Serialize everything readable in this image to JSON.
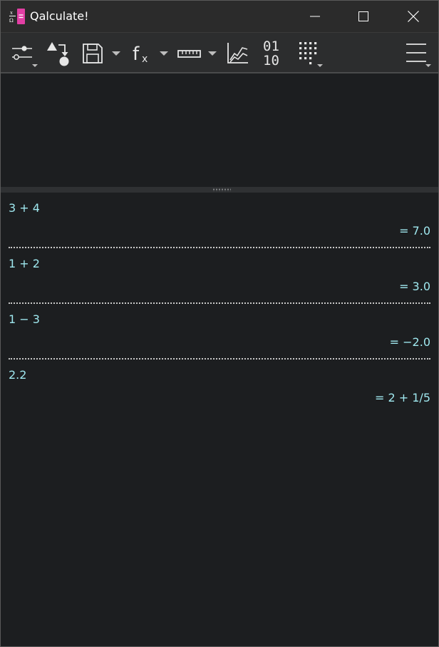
{
  "window": {
    "title": "Qalculate!",
    "app_icon": "qalculate-app-icon"
  },
  "toolbar": {
    "buttons": [
      {
        "icon": "mode-sliders-icon",
        "has_menu": true
      },
      {
        "icon": "convert-icon",
        "has_menu": false
      },
      {
        "icon": "save-icon",
        "has_menu": true
      },
      {
        "icon": "function-icon",
        "label": "f",
        "sub": "x",
        "has_menu": true
      },
      {
        "icon": "units-ruler-icon",
        "has_menu": true
      },
      {
        "icon": "plot-icon",
        "has_menu": false
      },
      {
        "icon": "number-bases-icon",
        "label_top": "01",
        "label_bottom": "10",
        "has_menu": false
      },
      {
        "icon": "keypad-icon",
        "has_menu": true
      },
      {
        "icon": "hamburger-menu-icon",
        "has_menu": true
      }
    ]
  },
  "expression": {
    "value": "",
    "placeholder": ""
  },
  "history": [
    {
      "expression": "3 + 4",
      "result": "= 7.0"
    },
    {
      "expression": "1 + 2",
      "result": "= 3.0"
    },
    {
      "expression": "1 − 3",
      "result": "= −2.0"
    },
    {
      "expression": "2.2",
      "result": "= 2 + 1∕5"
    }
  ],
  "colors": {
    "background": "#1c1e20",
    "titlebar": "#2b2b2b",
    "toolbar": "#2c2d2e",
    "history_text": "#9fe8ef",
    "icon": "#e6e6e6"
  }
}
